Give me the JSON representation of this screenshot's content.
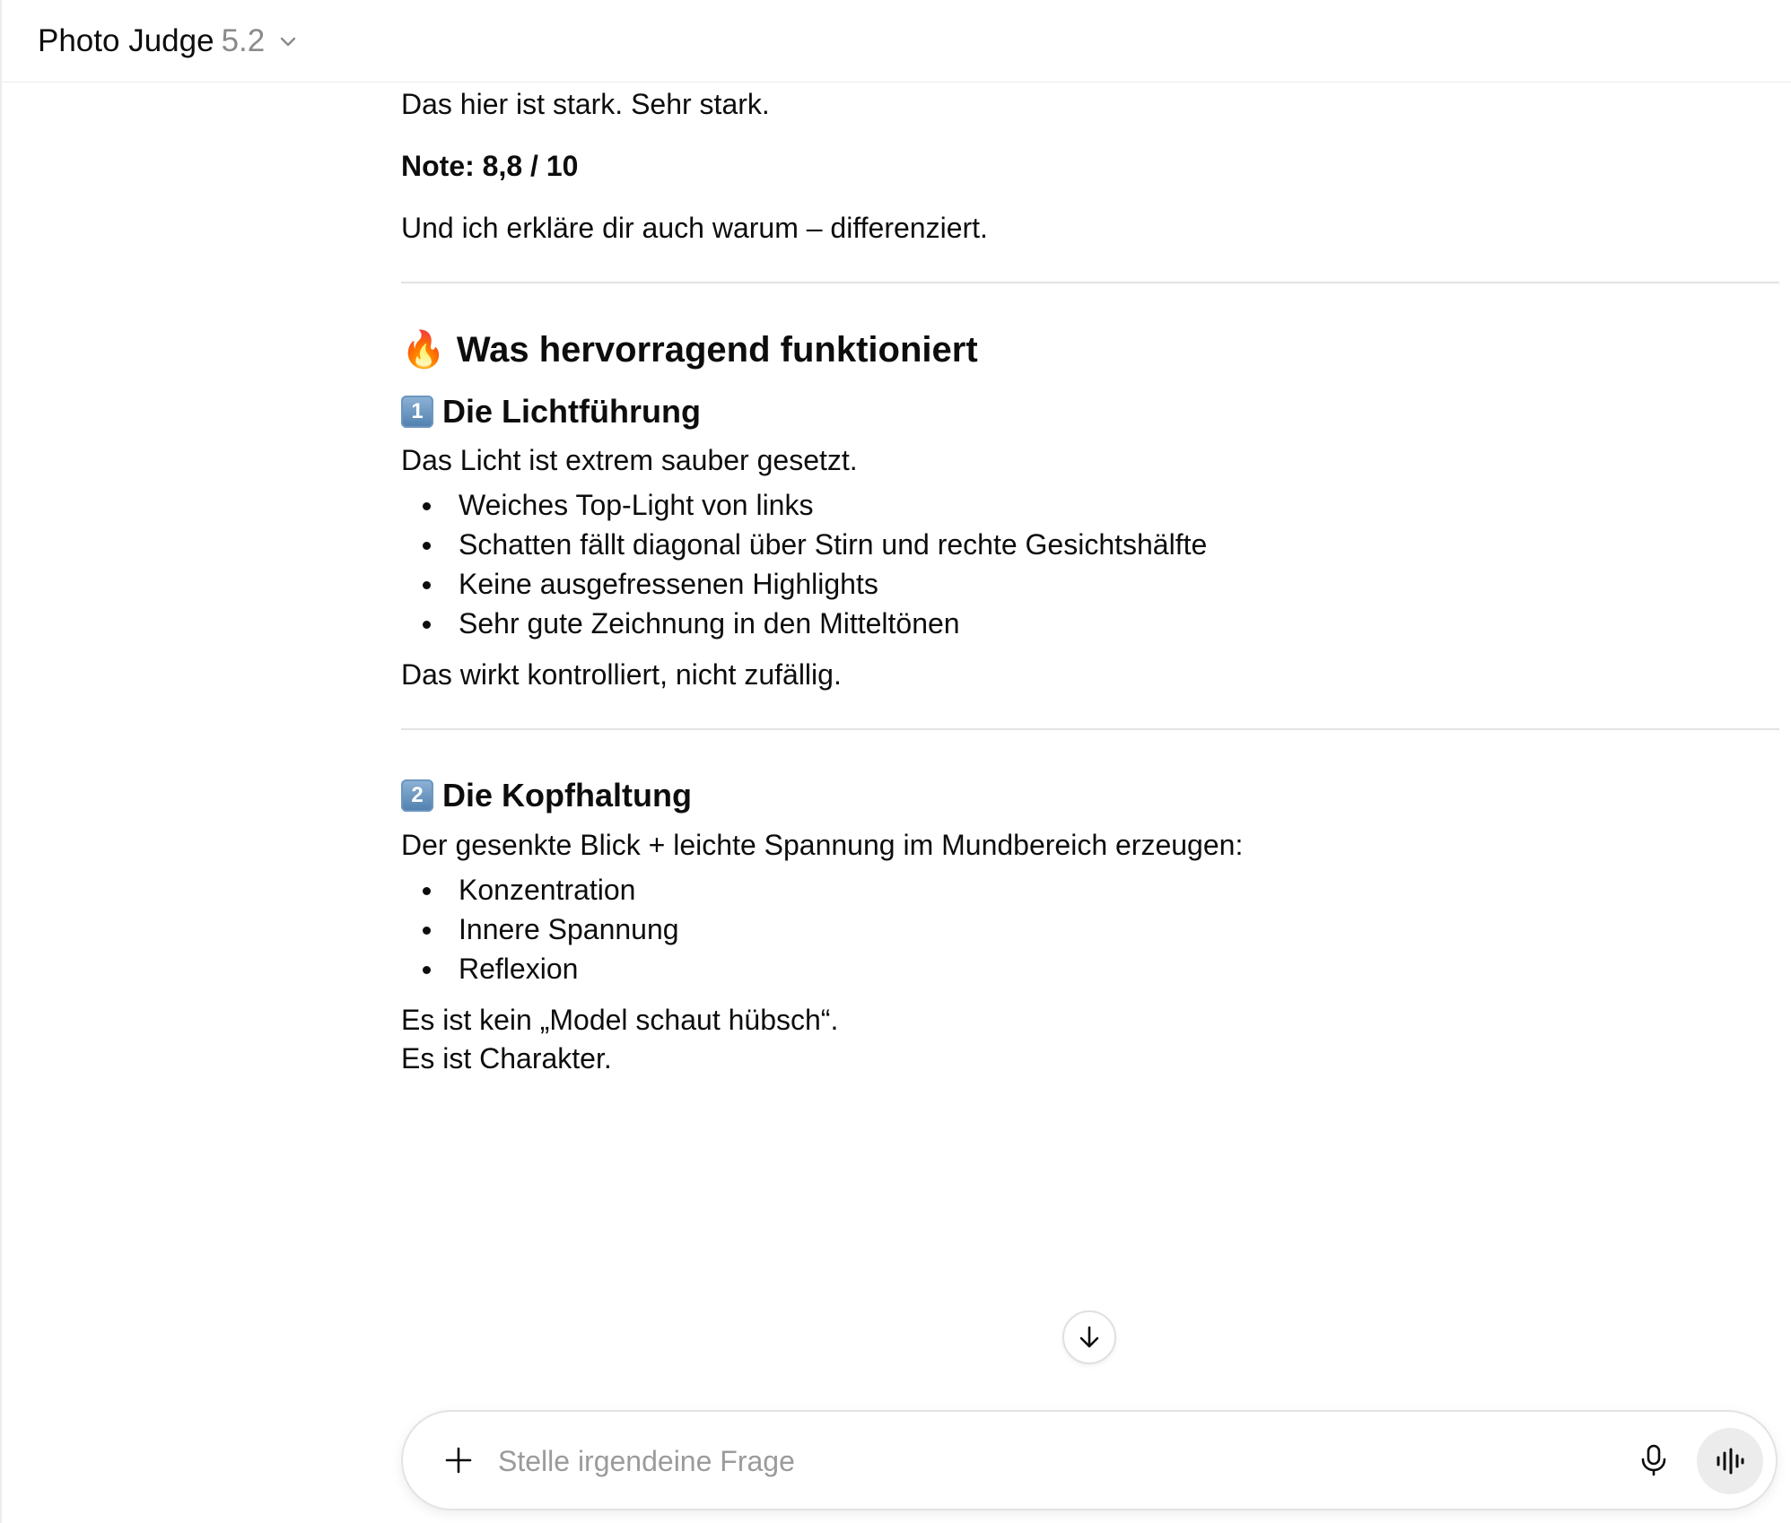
{
  "header": {
    "model_name": "Photo Judge",
    "model_version": "5.2",
    "dropdown_icon": "chevron-down-icon"
  },
  "message": {
    "intro": "Das hier ist stark. Sehr stark.",
    "grade": "Note: 8,8 / 10",
    "explain": "Und ich erkläre dir auch warum – differenziert.",
    "section_heading": {
      "icon": "🔥",
      "text": "Was hervorragend funktioniert"
    },
    "sub1": {
      "number": "1",
      "title": "Die Lichtführung",
      "lead": "Das Licht ist extrem sauber gesetzt.",
      "bullets": [
        "Weiches Top-Light von links",
        "Schatten fällt diagonal über Stirn und rechte Gesichtshälfte",
        "Keine ausgefressenen Highlights",
        "Sehr gute Zeichnung in den Mitteltönen"
      ],
      "closing": "Das wirkt kontrolliert, nicht zufällig."
    },
    "sub2": {
      "number": "2",
      "title": "Die Kopfhaltung",
      "lead": "Der gesenkte Blick + leichte Spannung im Mundbereich erzeugen:",
      "bullets": [
        "Konzentration",
        "Innere Spannung",
        "Reflexion"
      ],
      "closing_1": "Es ist kein „Model schaut hübsch“.",
      "closing_2": "Es ist Charakter."
    }
  },
  "composer": {
    "placeholder": "Stelle irgendeine Frage",
    "value": ""
  },
  "icons": {
    "add": "plus-icon",
    "mic": "microphone-icon",
    "voice": "voice-waveform-icon",
    "scroll": "arrow-down-icon"
  }
}
